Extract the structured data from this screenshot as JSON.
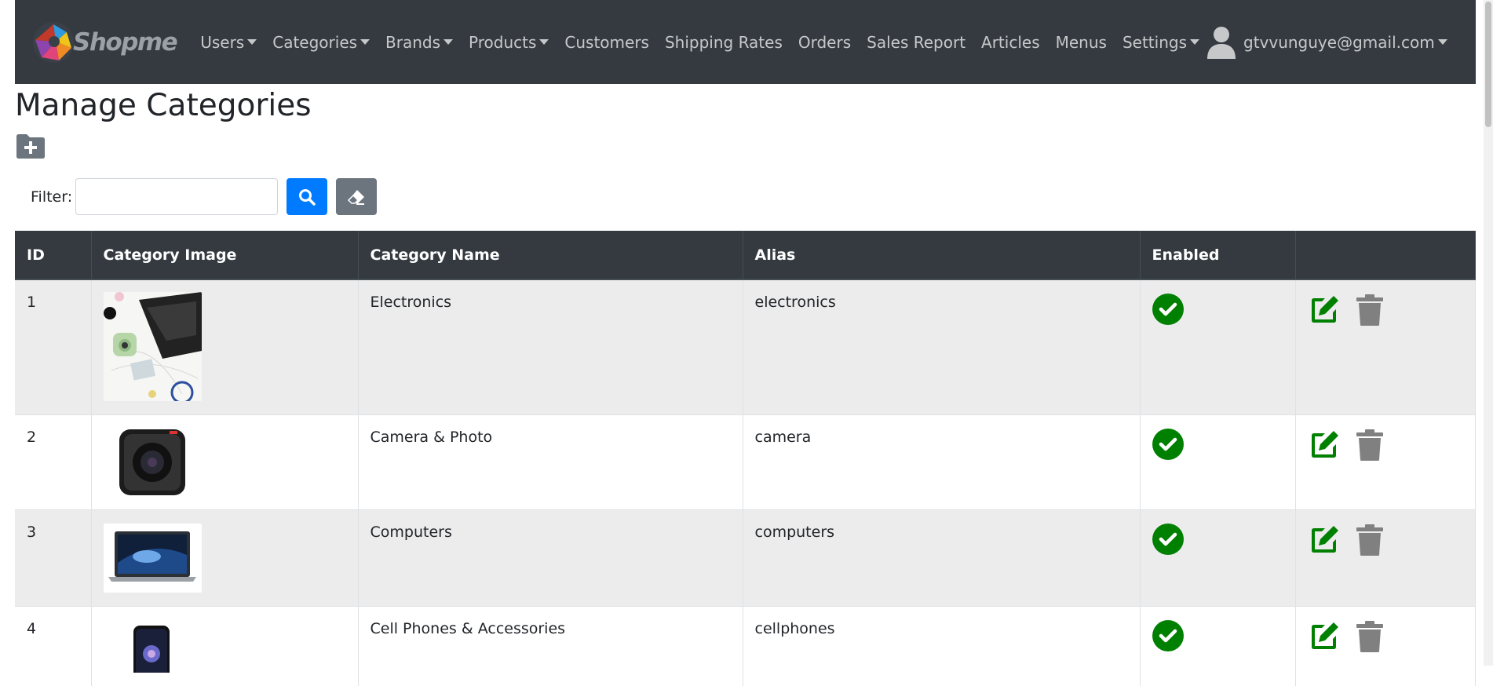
{
  "brand": {
    "name": "Shopme"
  },
  "nav": {
    "items": [
      {
        "label": "Users",
        "dropdown": true
      },
      {
        "label": "Categories",
        "dropdown": true
      },
      {
        "label": "Brands",
        "dropdown": true
      },
      {
        "label": "Products",
        "dropdown": true
      },
      {
        "label": "Customers",
        "dropdown": false
      },
      {
        "label": "Shipping Rates",
        "dropdown": false
      },
      {
        "label": "Orders",
        "dropdown": false
      },
      {
        "label": "Sales Report",
        "dropdown": false
      },
      {
        "label": "Articles",
        "dropdown": false
      },
      {
        "label": "Menus",
        "dropdown": false
      },
      {
        "label": "Settings",
        "dropdown": true
      }
    ],
    "user_email": "gtvvunguye@gmail.com"
  },
  "page": {
    "title": "Manage Categories"
  },
  "filter": {
    "label": "Filter:",
    "value": "",
    "placeholder": ""
  },
  "table": {
    "columns": [
      "ID",
      "Category Image",
      "Category Name",
      "Alias",
      "Enabled",
      ""
    ],
    "rows": [
      {
        "id": "1",
        "image": "electronics-image",
        "name": "Electronics",
        "alias": "electronics",
        "enabled": true
      },
      {
        "id": "2",
        "image": "camera-image",
        "name": "Camera & Photo",
        "alias": "camera",
        "enabled": true
      },
      {
        "id": "3",
        "image": "computers-image",
        "name": "Computers",
        "alias": "computers",
        "enabled": true
      },
      {
        "id": "4",
        "image": "cellphones-image",
        "name": "Cell Phones & Accessories",
        "alias": "cellphones",
        "enabled": true
      }
    ]
  },
  "colors": {
    "navbar": "#343a40",
    "primary": "#007bff",
    "secondary": "#6c757d",
    "enabled_green": "#008000",
    "edit_green": "#008000",
    "delete_gray": "#808080"
  }
}
